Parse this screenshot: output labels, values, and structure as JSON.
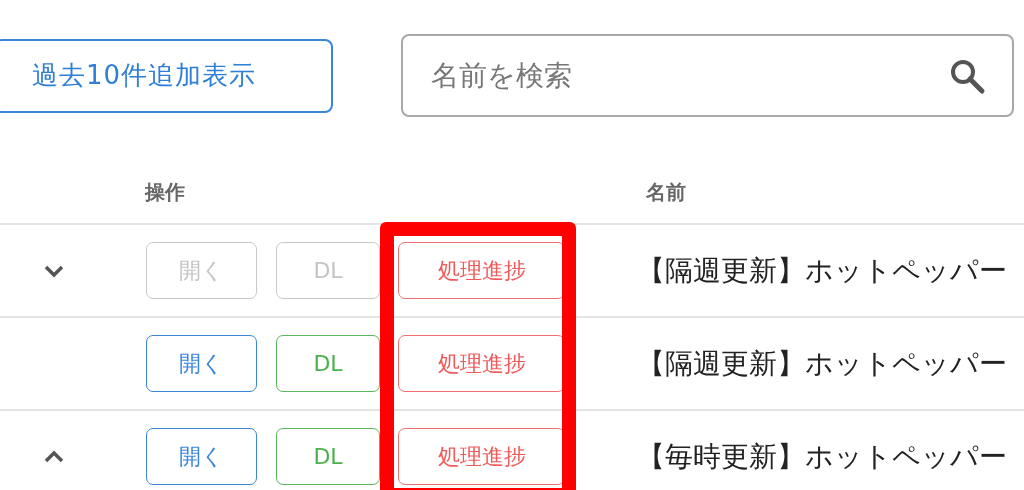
{
  "toolbar": {
    "load_more_button": "過去10件追加表示",
    "search": {
      "placeholder": "名前を検索"
    }
  },
  "table": {
    "columns": [
      "操作",
      "名前"
    ],
    "rows": [
      {
        "expanded": false,
        "disabled": true,
        "open_button": "開く",
        "download_button": "DL",
        "progress_button": "処理進捗",
        "name": "【隔週更新】ホットペッパー"
      },
      {
        "disabled": false,
        "open_button": "開く",
        "download_button": "DL",
        "progress_button": "処理進捗",
        "name": "【隔週更新】ホットペッパー"
      },
      {
        "expanded": true,
        "disabled": false,
        "open_button": "開く",
        "download_button": "DL",
        "progress_button": "処理進捗",
        "name": "【毎時更新】ホットペッパー"
      }
    ]
  },
  "annotation": {
    "kind": "highlight",
    "color": "#ff0000"
  }
}
